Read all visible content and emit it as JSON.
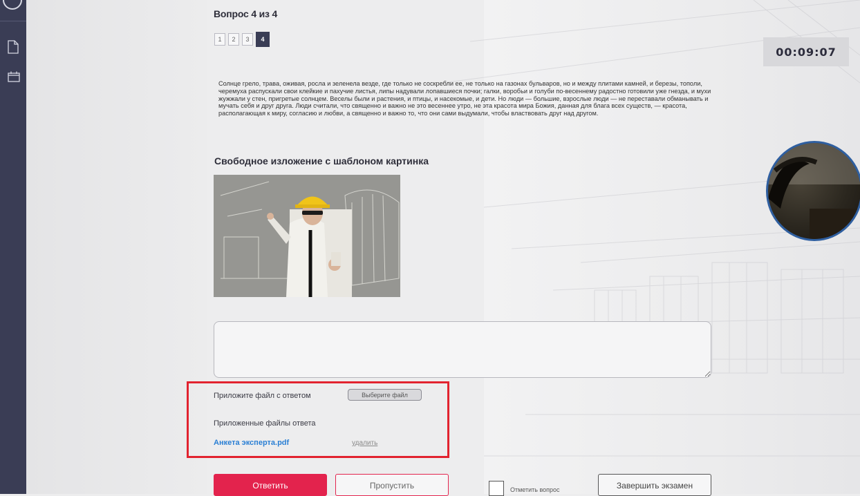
{
  "question": {
    "title": "Вопрос 4 из 4",
    "pages": [
      "1",
      "2",
      "3",
      "4"
    ],
    "current_page": "4",
    "passage": "Солнце грело, трава, оживая, росла и зеленела везде, где только не соскребли ее, не только на газонах бульваров, но и между плитами камней, и березы, тополи, черемуха распускали свои клейкие и пахучие листья, липы надували лопавшиеся почки; галки, воробьи и голуби по-весеннему радостно готовили уже гнезда, и мухи жужжали у стен, пригретые солнцем. Веселы были и растения, и птицы, и насекомые, и дети. Но люди — большие, взрослые люди — не переставали обманывать и мучать себя и друг друга. Люди считали, что священно и важно не это весеннее утро, не эта красота мира Божия, данная для блага всех существ, — красота, располагающая к миру, согласию и любви, а священно и важно то, что они сами выдумали, чтобы властвовать друг над другом.",
    "subtitle": "Свободное изложение с шаблоном картинка"
  },
  "timer": "00:09:07",
  "attachment": {
    "label": "Приложите файл с ответом",
    "choose_button": "Выберите файл",
    "attached_label": "Приложенные файлы ответа",
    "file_name": "Анкета эксперта.pdf",
    "delete_link": "удалить"
  },
  "actions": {
    "answer": "Ответить",
    "skip": "Пропустить",
    "mark": "Отметить вопрос",
    "finish": "Завершить экзамен"
  },
  "colors": {
    "sidebar": "#3a3d55",
    "accent": "#e3234d",
    "link": "#2a7fd4",
    "highlight": "#e2232f"
  },
  "icons": [
    "document-icon",
    "calendar-icon",
    "user-icon"
  ]
}
